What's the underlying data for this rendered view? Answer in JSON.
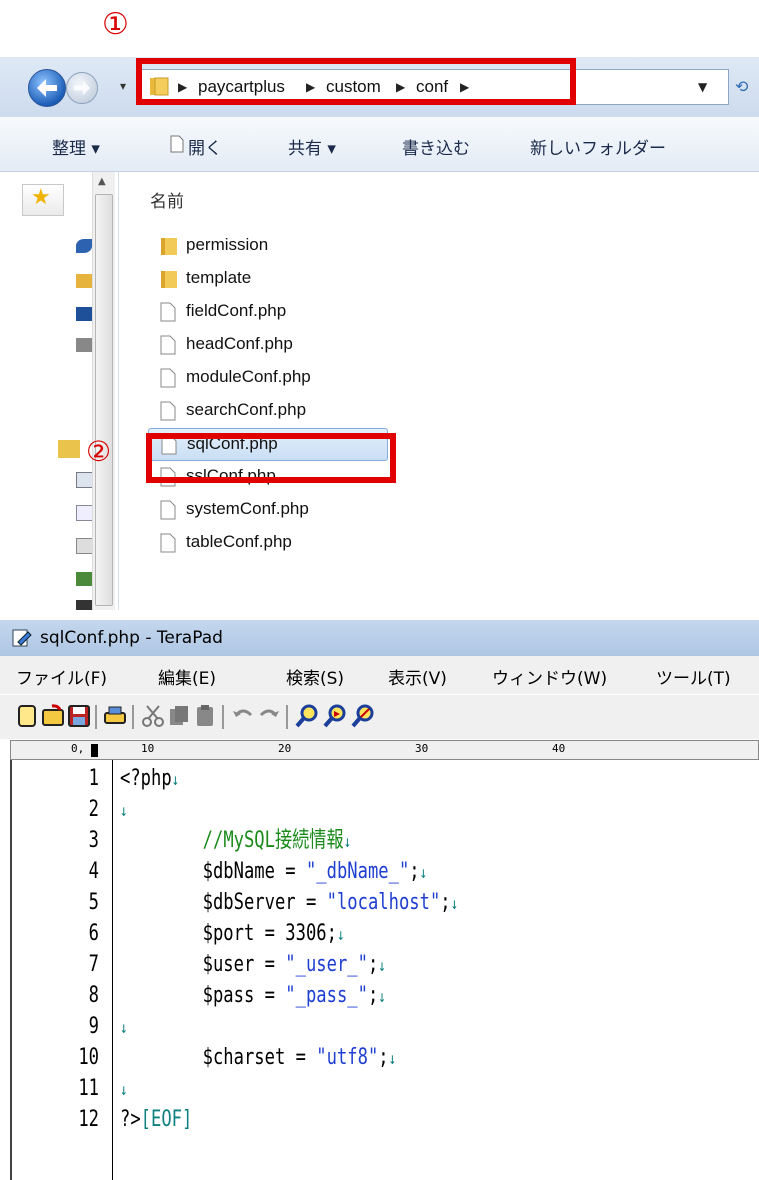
{
  "annotations": {
    "one": "①",
    "two": "②"
  },
  "explorer": {
    "breadcrumb": [
      "paycartplus",
      "custom",
      "conf"
    ],
    "toolbar": [
      "整理 ▾",
      "開く",
      "共有 ▾",
      "書き込む",
      "新しいフォルダー"
    ],
    "column_header": "名前",
    "files": [
      "permission",
      "template",
      "fieldConf.php",
      "headConf.php",
      "moduleConf.php",
      "searchConf.php",
      "sqlConf.php",
      "sslConf.php",
      "systemConf.php",
      "tableConf.php"
    ]
  },
  "terapad": {
    "title": "sqlConf.php - TeraPad",
    "menu": [
      "ファイル(F)",
      "編集(E)",
      "検索(S)",
      "表示(V)",
      "ウィンドウ(W)",
      "ツール(T)"
    ],
    "ruler": [
      "0,",
      "10",
      "20",
      "30",
      "40"
    ],
    "lines": [
      {
        "n": "1",
        "pre": "<?php",
        "cmt": "",
        "str": "",
        "post": ""
      },
      {
        "n": "2",
        "pre": "",
        "cmt": "",
        "str": "",
        "post": ""
      },
      {
        "n": "3",
        "pre": "        ",
        "cmt": "//MySQL接続情報",
        "str": "",
        "post": ""
      },
      {
        "n": "4",
        "pre": "        $dbName = ",
        "cmt": "",
        "str": "\"_dbName_\"",
        "post": ";"
      },
      {
        "n": "5",
        "pre": "        $dbServer = ",
        "cmt": "",
        "str": "\"localhost\"",
        "post": ";"
      },
      {
        "n": "6",
        "pre": "        $port = 3306;",
        "cmt": "",
        "str": "",
        "post": ""
      },
      {
        "n": "7",
        "pre": "        $user = ",
        "cmt": "",
        "str": "\"_user_\"",
        "post": ";"
      },
      {
        "n": "8",
        "pre": "        $pass = ",
        "cmt": "",
        "str": "\"_pass_\"",
        "post": ";"
      },
      {
        "n": "9",
        "pre": "",
        "cmt": "",
        "str": "",
        "post": ""
      },
      {
        "n": "10",
        "pre": "        $charset = ",
        "cmt": "",
        "str": "\"utf8\"",
        "post": ";"
      },
      {
        "n": "11",
        "pre": "",
        "cmt": "",
        "str": "",
        "post": ""
      },
      {
        "n": "12",
        "pre": "?>",
        "cmt": "",
        "str": "",
        "post": ""
      }
    ],
    "eol_mark": "↓",
    "eof": "[EOF]"
  }
}
